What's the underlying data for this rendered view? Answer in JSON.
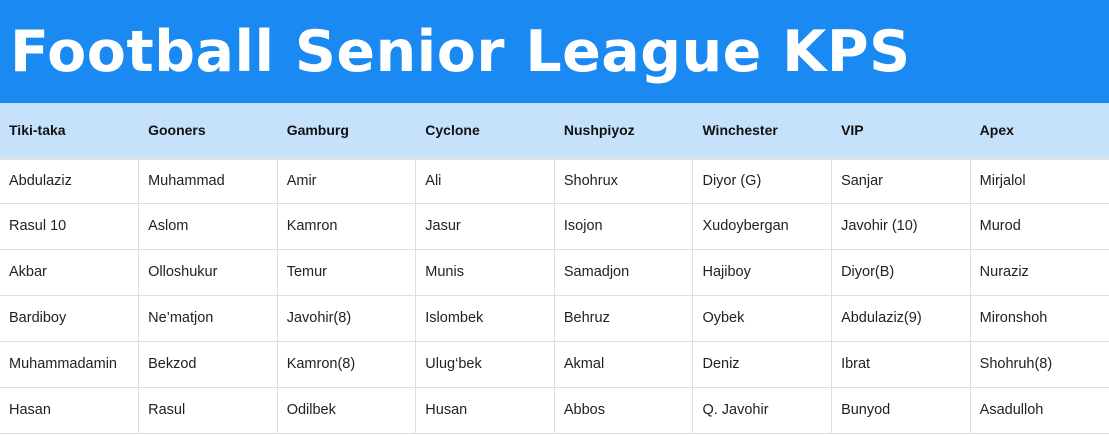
{
  "title": "Football Senior League KPS",
  "colors": {
    "title_bar": "#1a8af2",
    "header_row": "#c6e2fb",
    "title_text": "#ffffff"
  },
  "teams": [
    "Tiki-taka",
    "Gooners",
    "Gamburg",
    "Cyclone",
    "Nushpiyoz",
    "Winchester",
    "VIP",
    "Apex"
  ],
  "rows": [
    [
      "Abdulaziz",
      "Muhammad",
      "Amir",
      "Ali",
      "Shohrux",
      "Diyor (G)",
      "Sanjar",
      "Mirjalol"
    ],
    [
      "Rasul 10",
      "Aslom",
      "Kamron",
      "Jasur",
      "Isojon",
      "Xudoybergan",
      "Javohir (10)",
      "Murod"
    ],
    [
      "Akbar",
      "Olloshukur",
      "Temur",
      "Munis",
      "Samadjon",
      "Hajiboy",
      "Diyor(B)",
      "Nuraziz"
    ],
    [
      "Bardiboy",
      "Ne’matjon",
      "Javohir(8)",
      "Islombek",
      "Behruz",
      "Oybek",
      "Abdulaziz(9)",
      "Mironshoh"
    ],
    [
      "Muhammadamin",
      "Bekzod",
      "Kamron(8)",
      "Ulug‘bek",
      "Akmal",
      "Deniz",
      "Ibrat",
      "Shohruh(8)"
    ],
    [
      "Hasan",
      "Rasul",
      "Odilbek",
      "Husan",
      "Abbos",
      "Q. Javohir",
      "Bunyod",
      "Asadulloh"
    ]
  ]
}
